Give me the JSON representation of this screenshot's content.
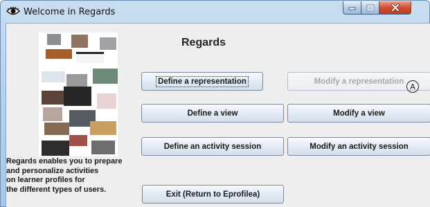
{
  "window": {
    "title": "Welcome in Regards",
    "icon": "eye-icon",
    "controls": [
      "minimize-icon",
      "maximize-icon",
      "close-icon"
    ]
  },
  "main": {
    "heading": "Regards",
    "description_lines": [
      "Regards enables you to prepare",
      "and personalize activities",
      "on learner profiles for",
      "the different types of users."
    ],
    "buttons": {
      "define_representation": "Define a representation",
      "modify_representation": "Modify a representation",
      "define_view": "Define a view",
      "modify_view": "Modify a view",
      "define_activity": "Define an activity session",
      "modify_activity": "Modify an activity session",
      "exit": "Exit (Return to Eprofilea)"
    },
    "states": {
      "modify_representation_enabled": false,
      "define_representation_focused": true
    },
    "annotation_marker": "A"
  },
  "colors": {
    "title_bar": "#b7d2ea",
    "client_bg": "#eeeeee",
    "close_button": "#c8452b",
    "disabled_text": "#a8a8a8"
  }
}
